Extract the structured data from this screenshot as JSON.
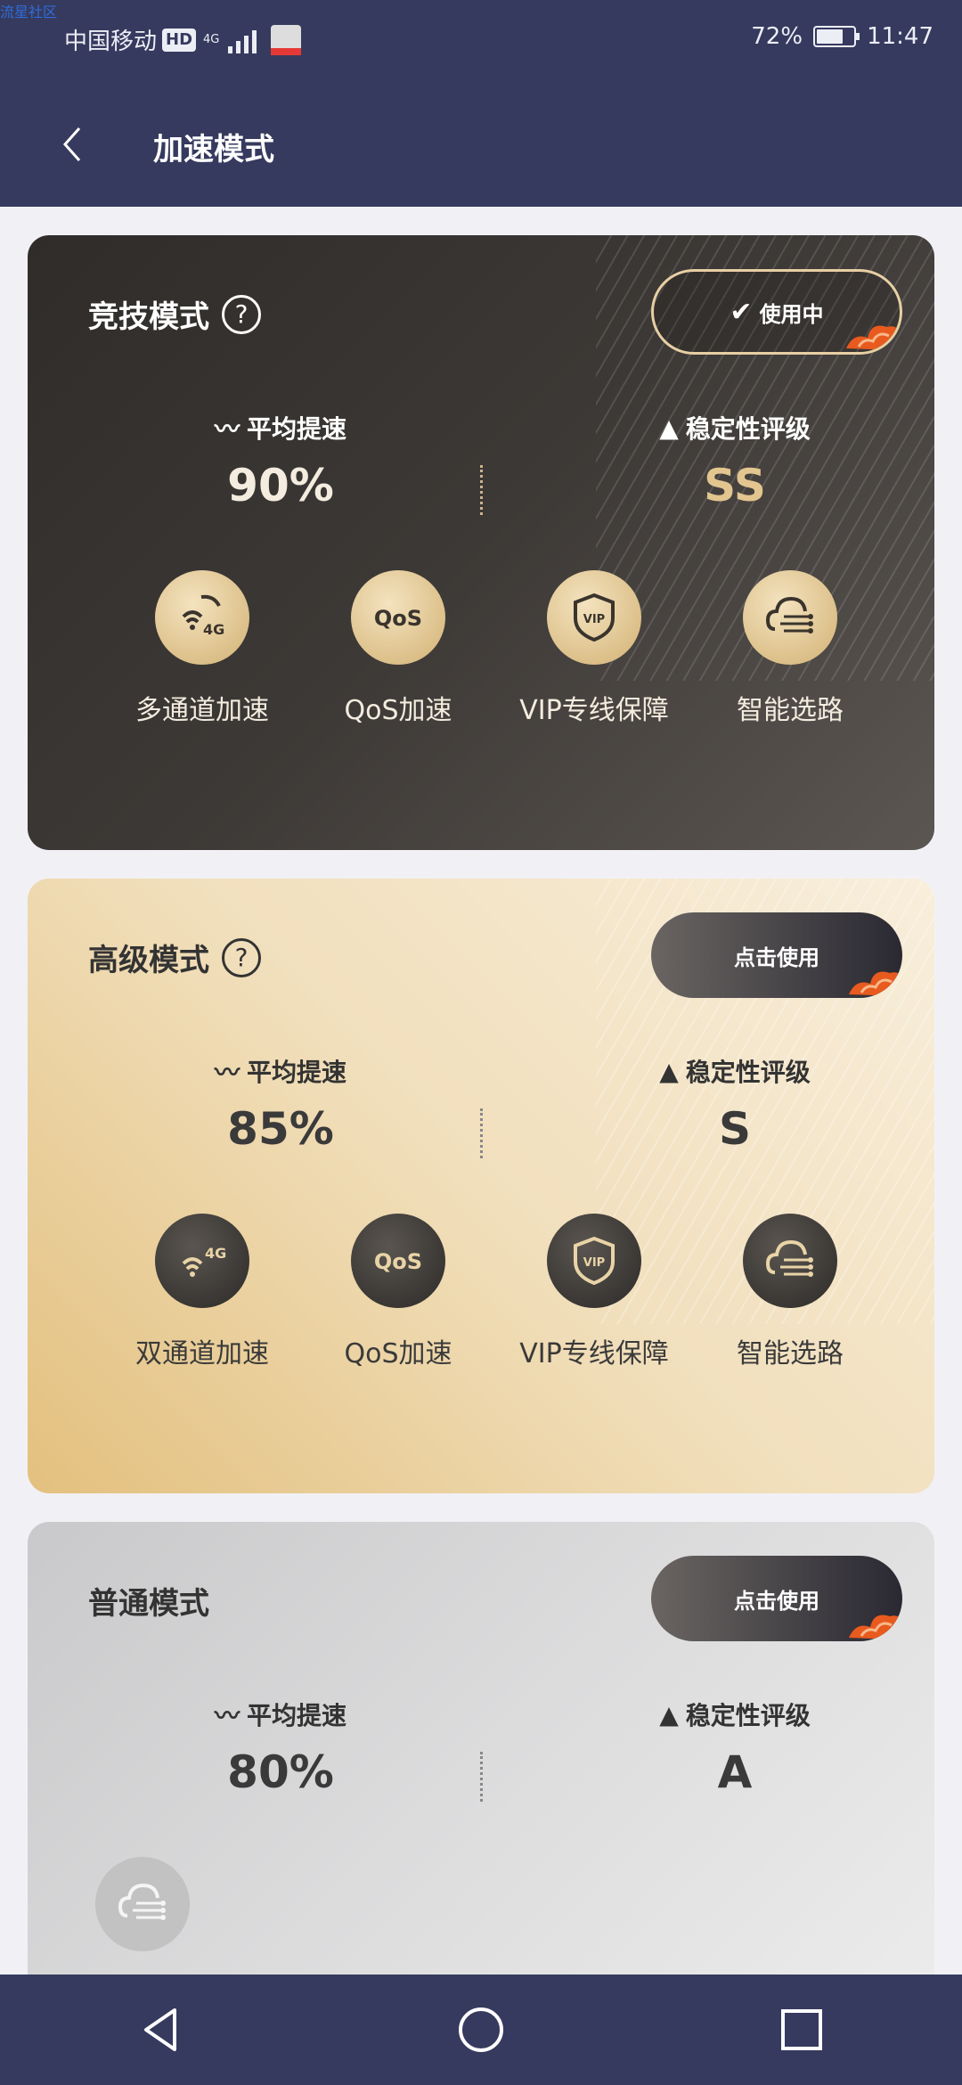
{
  "watermark": "流星社区",
  "status_bar": {
    "carrier": "中国移动",
    "hd": "HD",
    "network": "4G",
    "battery_percent": "72%",
    "battery_level": 0.72,
    "time": "11:47"
  },
  "header": {
    "title": "加速模式"
  },
  "cards": [
    {
      "title": "竞技模式",
      "help": "?",
      "button_label": "使用中",
      "button_state": "in-use",
      "avg_label": "平均提速",
      "avg_value": "90%",
      "stability_label": "稳定性评级",
      "stability_value": "SS",
      "features": [
        {
          "label": "多通道加速",
          "icon": "multi-channel-icon"
        },
        {
          "label": "QoS加速",
          "icon": "qos-icon"
        },
        {
          "label": "VIP专线保障",
          "icon": "vip-shield-icon"
        },
        {
          "label": "智能选路",
          "icon": "smart-route-icon"
        }
      ]
    },
    {
      "title": "高级模式",
      "help": "?",
      "button_label": "点击使用",
      "button_state": "available",
      "avg_label": "平均提速",
      "avg_value": "85%",
      "stability_label": "稳定性评级",
      "stability_value": "S",
      "features": [
        {
          "label": "双通道加速",
          "icon": "dual-channel-icon"
        },
        {
          "label": "QoS加速",
          "icon": "qos-icon"
        },
        {
          "label": "VIP专线保障",
          "icon": "vip-shield-icon"
        },
        {
          "label": "智能选路",
          "icon": "smart-route-icon"
        }
      ]
    },
    {
      "title": "普通模式",
      "button_label": "点击使用",
      "button_state": "available",
      "avg_label": "平均提速",
      "avg_value": "80%",
      "stability_label": "稳定性评级",
      "stability_value": "A",
      "features": [
        {
          "icon": "smart-route-icon"
        }
      ]
    }
  ],
  "icon_text": {
    "qos": "QoS",
    "vip": "VIP",
    "fourg": "4G"
  },
  "colors": {
    "header_bg": "#363a5e",
    "gold": "#e2c58f",
    "dark_card": "#3d3936"
  }
}
